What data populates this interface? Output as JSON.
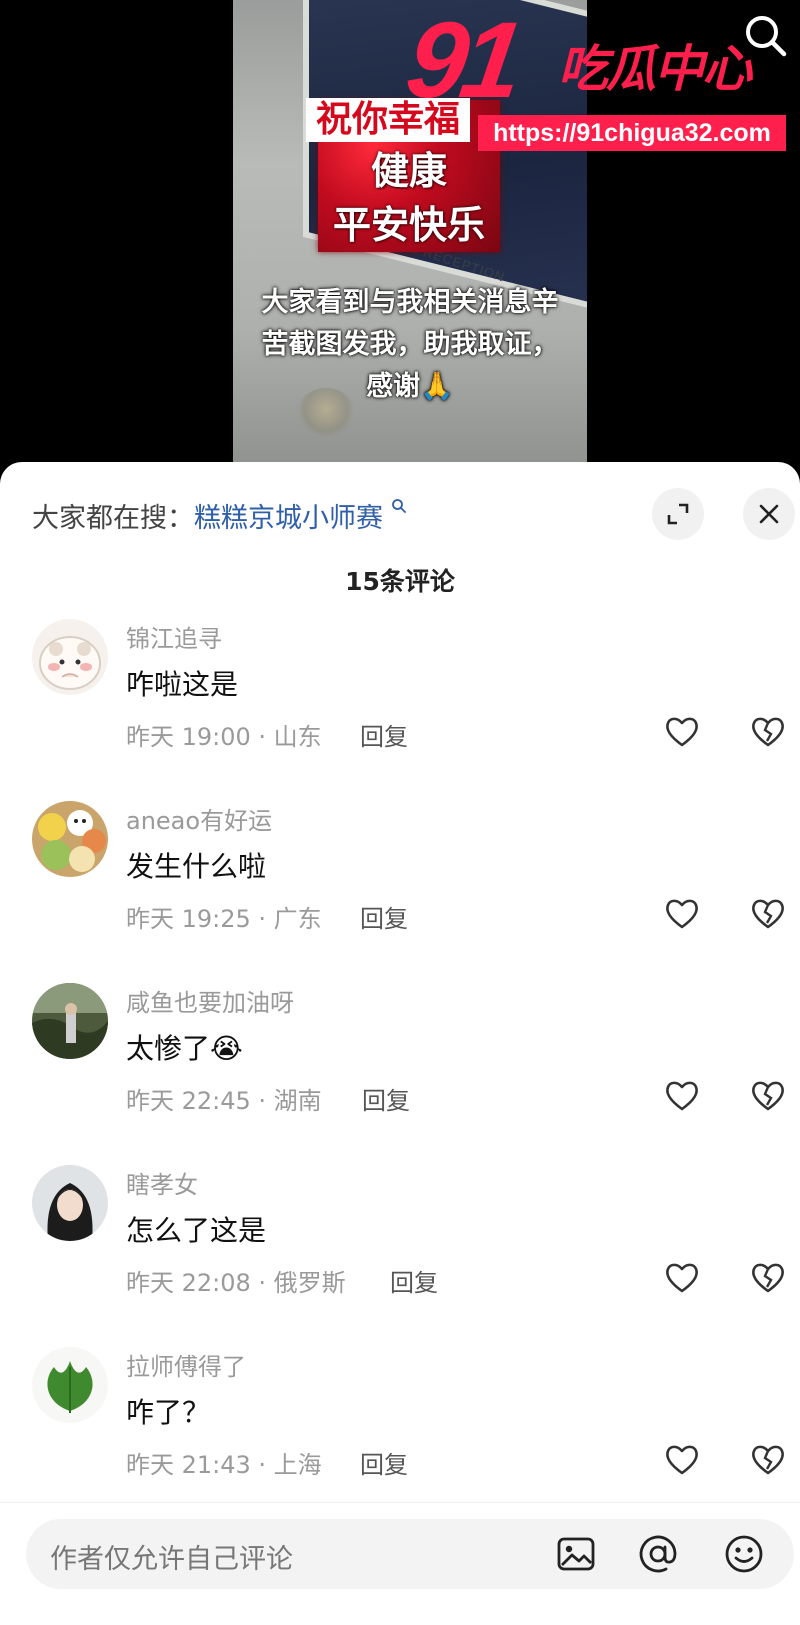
{
  "video": {
    "banner_lines": [
      "祝你幸福",
      "健康",
      "平安快乐"
    ],
    "sign_text": "POLICE RECEPTION",
    "caption": "大家看到与我相关消息辛苦截图发我，助我取证，感谢🙏"
  },
  "watermark": {
    "number": "91",
    "title": "吃瓜中心",
    "url": "https://91chigua32.com"
  },
  "top_icons": {
    "search": "search-icon"
  },
  "sheet": {
    "hot_search_label": "大家都在搜：",
    "hot_search_keyword": "糕糕京城小师赛",
    "comment_count": "15条评论",
    "expand_icon": "expand-icon",
    "close_icon": "close-icon"
  },
  "comments": [
    {
      "user": "锦江追寻",
      "text": "咋啦这是",
      "meta": "昨天 19:00 · 山东",
      "reply": "回复",
      "avatar": "cartoon-face-avatar"
    },
    {
      "user": "aneao有好运",
      "text": "发生什么啦",
      "meta": "昨天 19:25 · 广东",
      "reply": "回复",
      "avatar": "plush-toys-avatar"
    },
    {
      "user": "咸鱼也要加油呀",
      "text": "太惨了😭",
      "meta": "昨天 22:45 · 湖南",
      "reply": "回复",
      "avatar": "outdoor-photo-avatar"
    },
    {
      "user": "瞎孝女",
      "text": "怎么了这是",
      "meta": "昨天 22:08 · 俄罗斯",
      "reply": "回复",
      "avatar": "portrait-avatar"
    },
    {
      "user": "拉师傅得了",
      "text": "咋了？",
      "meta": "昨天 21:43 · 上海",
      "reply": "回复",
      "avatar": "green-leaf-avatar"
    }
  ],
  "input": {
    "placeholder": "作者仅允许自己评论",
    "icons": [
      "image-icon",
      "at-icon",
      "emoji-icon"
    ]
  },
  "colors": {
    "accent_red": "#ff1f4c",
    "link_blue": "#2f5fa8",
    "muted_gray": "#9a9a9a"
  }
}
